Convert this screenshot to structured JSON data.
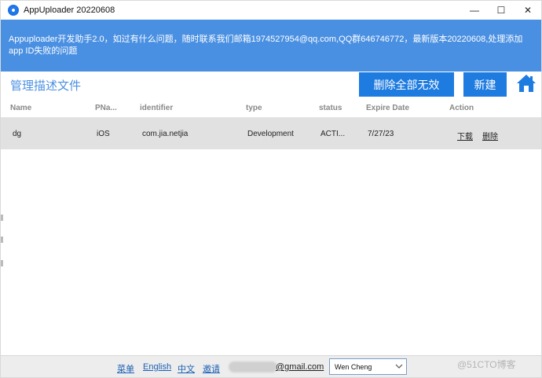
{
  "window": {
    "title": "AppUploader 20220608",
    "controls": {
      "minimize": "—",
      "maximize": "☐",
      "close": "✕"
    }
  },
  "banner": {
    "text": "Appuploader开发助手2.0，如过有什么问题，随时联系我们邮箱1974527954@qq.com,QQ群646746772，最新版本20220608,处理添加app ID失败的问题"
  },
  "toolbar": {
    "page_title": "管理描述文件",
    "delete_all_label": "删除全部无效",
    "new_label": "新建",
    "home_icon": "home-icon"
  },
  "table": {
    "columns": [
      "Name",
      "PNa...",
      "identifier",
      "type",
      "status",
      "Expire Date",
      "Action"
    ],
    "rows": [
      {
        "name": "dg",
        "platform": "iOS",
        "identifier": "com.jia.netjia",
        "type": "Development",
        "status": "ACTI...",
        "expire_date": "7/27/23",
        "actions": [
          "下载",
          "删除"
        ]
      }
    ]
  },
  "footer": {
    "links": [
      "菜单",
      "English",
      "中文",
      "邀请"
    ],
    "email_domain": "@gmail.com",
    "account_select": {
      "selected": "Wen Cheng"
    }
  },
  "watermark": "@51CTO博客",
  "colors": {
    "banner": "#4a90e2",
    "button": "#1e7be0",
    "selected_row": "#e1e1e1",
    "link": "#1a5fb4"
  }
}
